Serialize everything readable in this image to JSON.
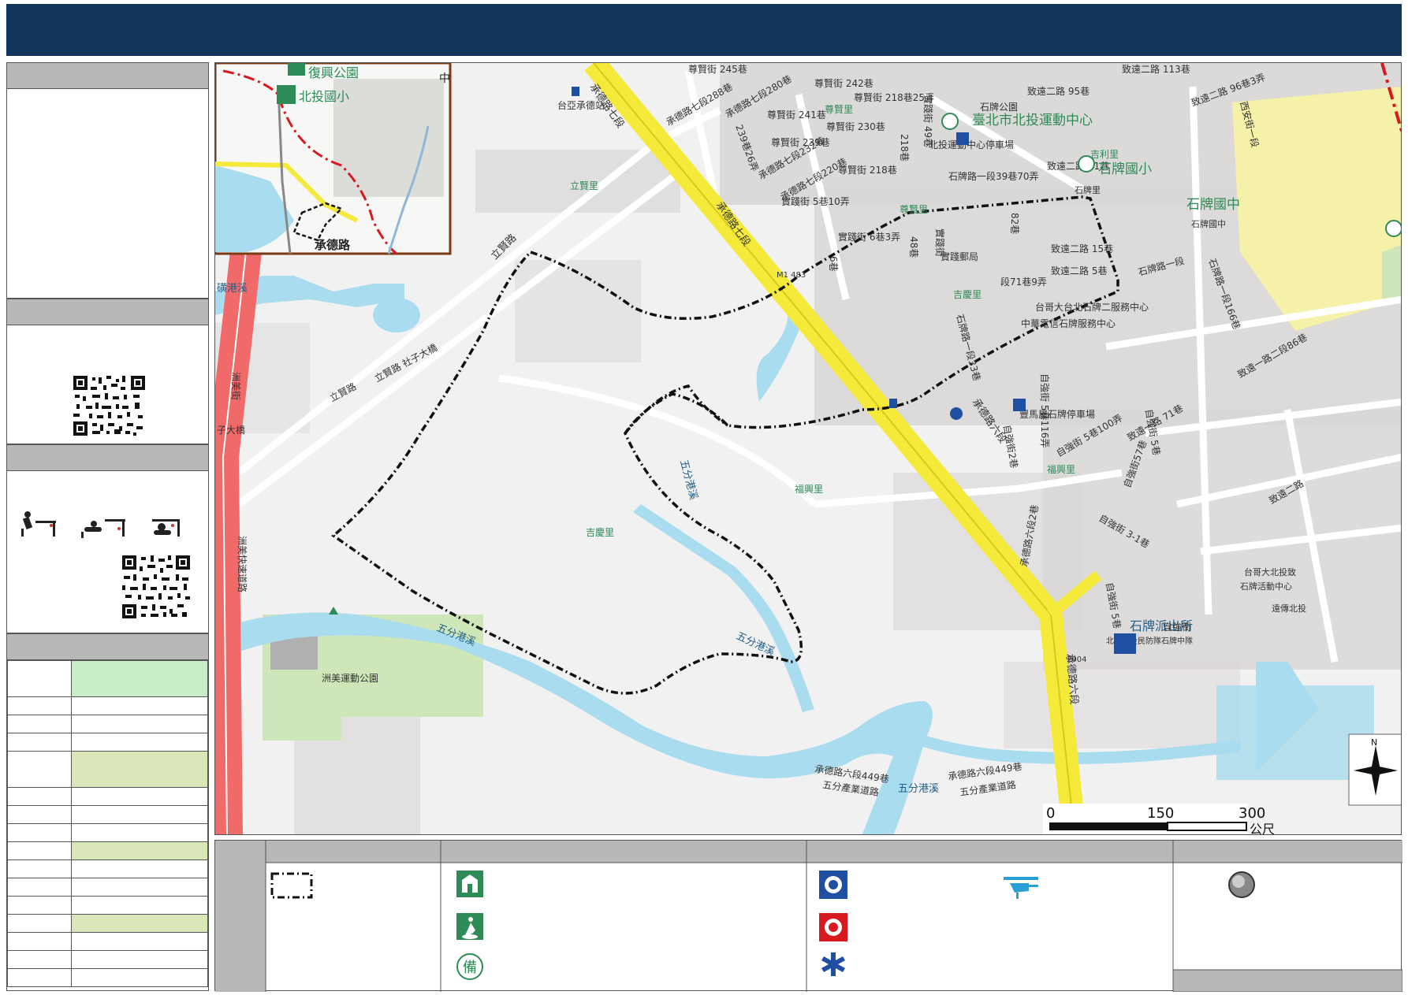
{
  "map": {
    "labels": {
      "fuxing_park": "復興公園",
      "beitou_elem": "北投國小",
      "zhong": "中",
      "chengde_rd": "承德路",
      "taiya_station": "台亞承德站",
      "lixian_rd": "立賢路",
      "lixian_li": "立賢里",
      "lixian_rd_2": "立賢路",
      "lixian_rd_shezi": "立賢路 社子大橋",
      "chengde_rd_7": "承德路七段",
      "chengde_rd_7_b": "承德路七段",
      "chengde_rd_7_288": "承德路七段288巷",
      "chengde_rd_7_280": "承德路七段280巷",
      "chengde_rd_7_232": "承德路七段232巷",
      "chengde_rd_7_220": "承德路七段220巷",
      "zunxian_245": "尊賢街 245巷",
      "zunxian_242": "尊賢街 242巷",
      "zunxian_241": "尊賢街 241巷",
      "zunxian_239_26": "239巷26弄",
      "zunxian_239": "尊賢街 239巷",
      "zunxian_230": "尊賢街 230巷",
      "zunxian_218_25": "尊賢街 218巷25弄",
      "zunxian_218": "尊賢街 218巷",
      "zunxian_218_v": "218巷",
      "zunxian_li": "尊賢里",
      "zunxian_li_2": "尊賢里",
      "shixian_49": "實踐街 49巷",
      "shixian_5_10": "實踐街 5巷10弄",
      "shixian_48": "48巷",
      "shixian_6_3": "實踐街 6巷3弄",
      "shixian_6": "6巷",
      "shixian_jie": "實踐街",
      "shixian_post": "實踐郵局",
      "stadium": "臺北市北投運動中心",
      "stadium_parking": "北投運動中心停車場",
      "shipai_park": "石牌公園",
      "shipai_rd_1_39_70": "石牌路一段39巷70弄",
      "zhiyuan_2_95": "致遠二路 95巷",
      "zhiyuan_2_113": "致遠二路 113巷",
      "zhiyuan_2_96_3": "致遠二路 96巷3弄",
      "zhiyuan_2_71": "致遠二路 71巷",
      "zhiyuan_2_15": "致遠二路 15巷",
      "zhiyuan_2_5": "致遠二路 5巷",
      "zhiyuan_1_2_86": "致遠一路二段86巷",
      "zhiyuan_1_71": "致遠一路 71巷",
      "shipai_elem": "石牌國小",
      "shipai_jh": "石牌國中",
      "shipai_jh_small": "石牌國中",
      "shipai_li": "石牌里",
      "shipai_rd_1": "石牌路一段",
      "shipai_rd_1_166": "石牌路一段166巷",
      "shipai_rd_1_33": "石牌路一段33巷",
      "shipai_rd_1_71_9": "段71巷9弄",
      "xian_an": "西安街一段",
      "jili_li": "吉利里",
      "jiqing_li": "吉慶里",
      "jiqing_li_2": "吉慶里",
      "kedadao": "82巷",
      "telecom": "台哥大台北石牌二服務中心",
      "cht": "中華電信石牌服務中心",
      "fuxing_li": "福興里",
      "fuxing_li_2": "福興里",
      "gangxing": "豐馬屋石牌停車場",
      "chengde_rd_6": "承德路六段",
      "chengde_rd_6_b": "承德路六段",
      "chengde_rd_6_449": "承德路六段449巷",
      "chengde_rd_6_449_b": "承德路六段449巷",
      "wufen_ind": "五分產業道路",
      "wufen_ind_b": "五分產業道路",
      "wufen_creek": "五分港溪",
      "wufen_creek_2": "五分港溪",
      "wufen_creek_3": "五分港溪",
      "wufen_creek_4": "五分港溪",
      "jigang_creek": "磺港溪",
      "zhoumei_jie": "洲美街",
      "zhoumei_expwy": "洲美快速道路",
      "shezi_bridge": "子大橋",
      "zhoumei_park": "洲美運動公園",
      "police": "石牌派出所",
      "police_sub": "北市北投民防隊石牌中隊",
      "zhiqiang_5_116": "自強街 5巷116弄",
      "zhiqiang_5_100": "自強街 5巷100弄",
      "zhiqiang_3_1": "自強街 3-1巷",
      "zhiqiang_5": "自強街 5巷",
      "zhiqiang_jie": "自強街",
      "zhiqiang_2": "自強街2巷",
      "chengde_6_2": "承德路六段2巷",
      "xiangde_5": "自強街 5巷",
      "ziqiang_57": "自強街57巷",
      "taiwan_da": "台哥大北投致",
      "shipai_center": "石牌活動中心",
      "yuan_bei": "遠傳北投",
      "zhiyuan_2_88": "致遠二路",
      "mile": "M1 483",
      "mile2": "2004"
    },
    "scale": {
      "zero": "0",
      "mid": "150",
      "max": "300",
      "unit": "公尺"
    },
    "north": "N",
    "colors": {
      "header": "#12355b",
      "expressway": "#f06a6a",
      "arterial": "#f5ea3a",
      "water": "#a9dcef",
      "park": "#cfe7b8",
      "school": "#f6f1a8",
      "building": "#d9d6d6"
    },
    "icons": {
      "shelter": "emergency-shelter-icon",
      "evacuation": "evacuation-area-icon",
      "reserve": "reserve-shelter-icon",
      "police": "police-station-icon",
      "fire": "fire-station-icon",
      "medical": "medical-icon",
      "helicopter": "helicopter-icon",
      "point": "point-icon"
    }
  }
}
